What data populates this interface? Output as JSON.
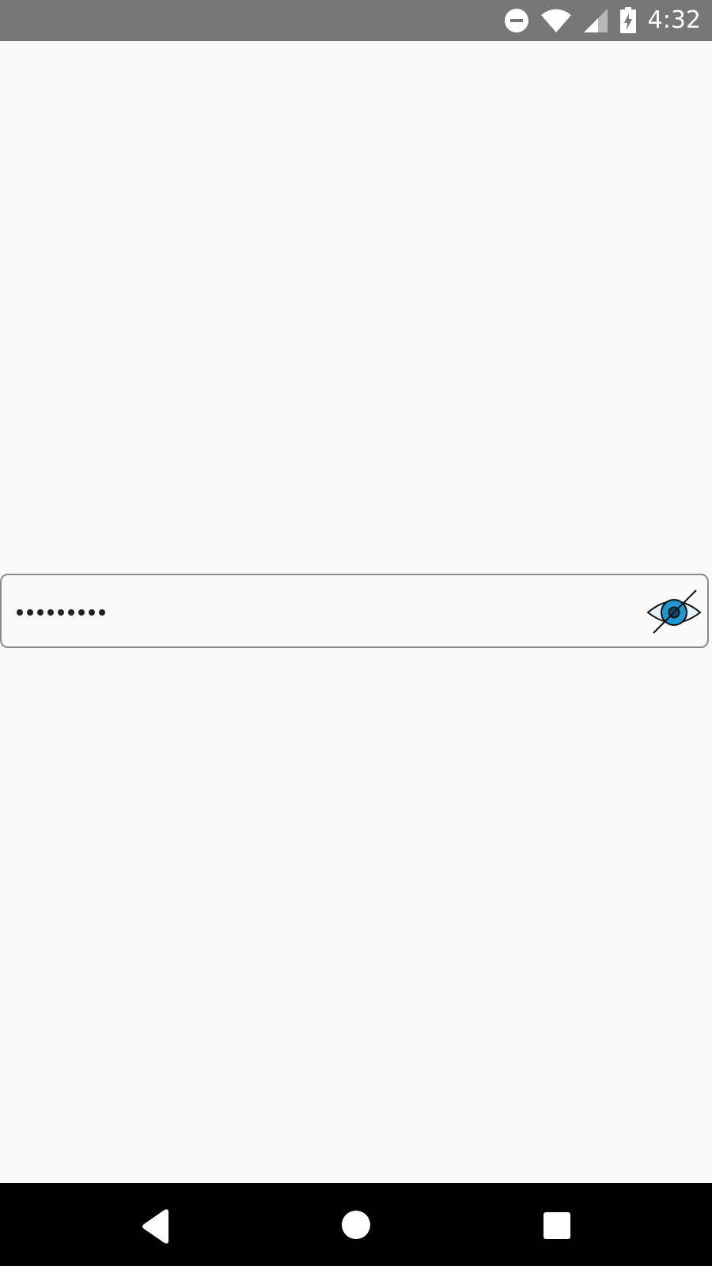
{
  "status_bar": {
    "time": "4:32",
    "icons": [
      "do-not-disturb-icon",
      "wifi-icon",
      "cellular-signal-icon",
      "battery-charging-icon"
    ]
  },
  "password_field": {
    "value": "•••••••••",
    "masked_length": 9,
    "visibility_toggle_icon": "eye-off-icon",
    "colors": {
      "border": "#8a8a8a",
      "eye_iris": "#2196d3",
      "eye_white": "#e3f2fb"
    }
  },
  "navigation_bar": {
    "buttons": [
      "back-icon",
      "home-icon",
      "recents-icon"
    ]
  },
  "colors": {
    "status_bar": "#777777",
    "background": "#fafafa",
    "nav_bar": "#000000"
  }
}
